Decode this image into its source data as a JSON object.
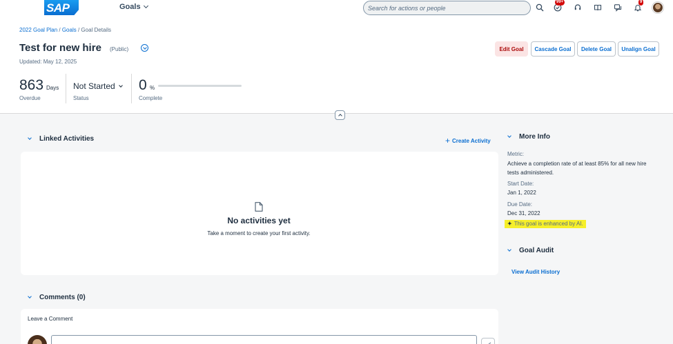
{
  "shell": {
    "logo_text": "SAP",
    "app_menu_label": "Goals",
    "search_placeholder": "Search for actions or people",
    "icons": [
      "search-icon",
      "todo-check-icon",
      "headset-icon",
      "learning-icon",
      "feedback-icon",
      "notification-bell-icon"
    ],
    "todo_badge": "99+",
    "notification_badge": "9"
  },
  "breadcrumb": {
    "items": [
      "2022 Goal Plan",
      "Goals"
    ],
    "current": "Goal Details",
    "separator": " / "
  },
  "goal": {
    "title": "Test for new hire",
    "visibility": "(Public)",
    "updated": "Updated: May 12, 2025"
  },
  "actions": {
    "edit": "Edit Goal",
    "cascade": "Cascade Goal",
    "delete": "Delete Goal",
    "unalign": "Unalign Goal"
  },
  "kpis": {
    "overdue_value": "863",
    "overdue_unit": "Days",
    "overdue_label": "Overdue",
    "status_value": "Not Started",
    "status_label": "Status",
    "complete_value": "0",
    "complete_unit": "%",
    "complete_label": "Complete",
    "complete_fraction": 0
  },
  "linked_activities": {
    "heading": "Linked Activities",
    "create_label": "Create Activity",
    "empty_title": "No activities yet",
    "empty_subtitle": "Take a moment to create your first activity."
  },
  "more_info": {
    "heading": "More Info",
    "metric_label": "Metric:",
    "metric_value": "Achieve a completion rate of at least 85% for all new hire tests administered.",
    "start_label": "Start Date:",
    "start_value": "Jan 1, 2022",
    "due_label": "Due Date:",
    "due_value": "Dec 31, 2022",
    "ai_note": "This goal is enhanced by AI."
  },
  "goal_audit": {
    "heading": "Goal Audit",
    "history_link": "View Audit History"
  },
  "comments": {
    "heading": "Comments (0)",
    "leave_label": "Leave a Comment"
  },
  "colors": {
    "accent": "#0a6ed1",
    "edit_bg": "#fbe4e4",
    "edit_text": "#aa0808",
    "highlight": "#f6ef2a",
    "badge": "#d20a0a"
  }
}
